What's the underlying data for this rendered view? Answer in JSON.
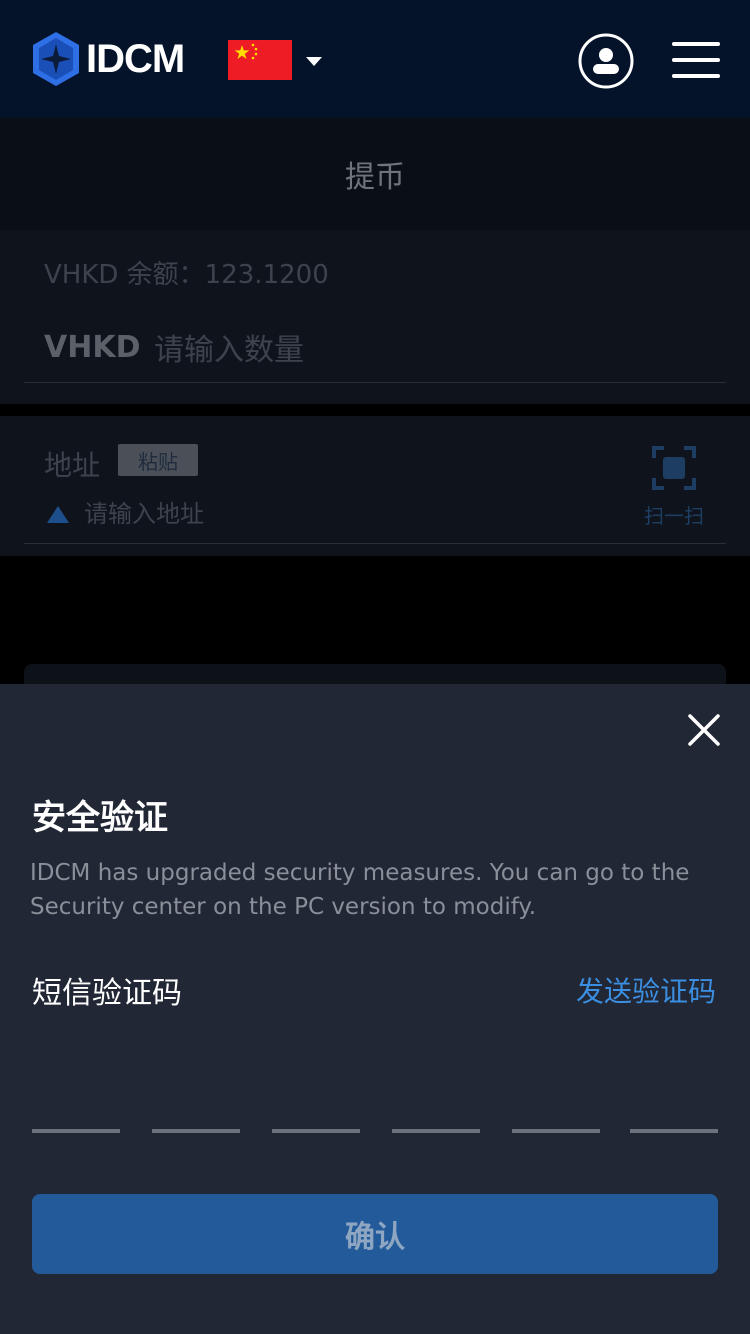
{
  "header": {
    "brand": "IDCM",
    "language_flag": "china-flag",
    "colors": {
      "background": "#04132a",
      "logo_blue": "#2f6fe6"
    }
  },
  "page": {
    "title": "提币"
  },
  "amount_section": {
    "balance_text": "VHKD 余额：123.1200",
    "currency": "VHKD",
    "amount_placeholder": "请输入数量"
  },
  "address_section": {
    "label": "地址",
    "paste_label": "粘贴",
    "address_placeholder": "请输入地址",
    "scan_label": "扫一扫"
  },
  "security_modal": {
    "title": "安全验证",
    "description": "IDCM has upgraded security measures. You can go to the Security center on the PC version to modify.",
    "sms_label": "短信验证码",
    "send_code_label": "发送验证码",
    "code_digits": 6,
    "confirm_label": "确认",
    "colors": {
      "link": "#3b8ee0",
      "button": "#235b9a",
      "sheet": "#212734"
    }
  }
}
